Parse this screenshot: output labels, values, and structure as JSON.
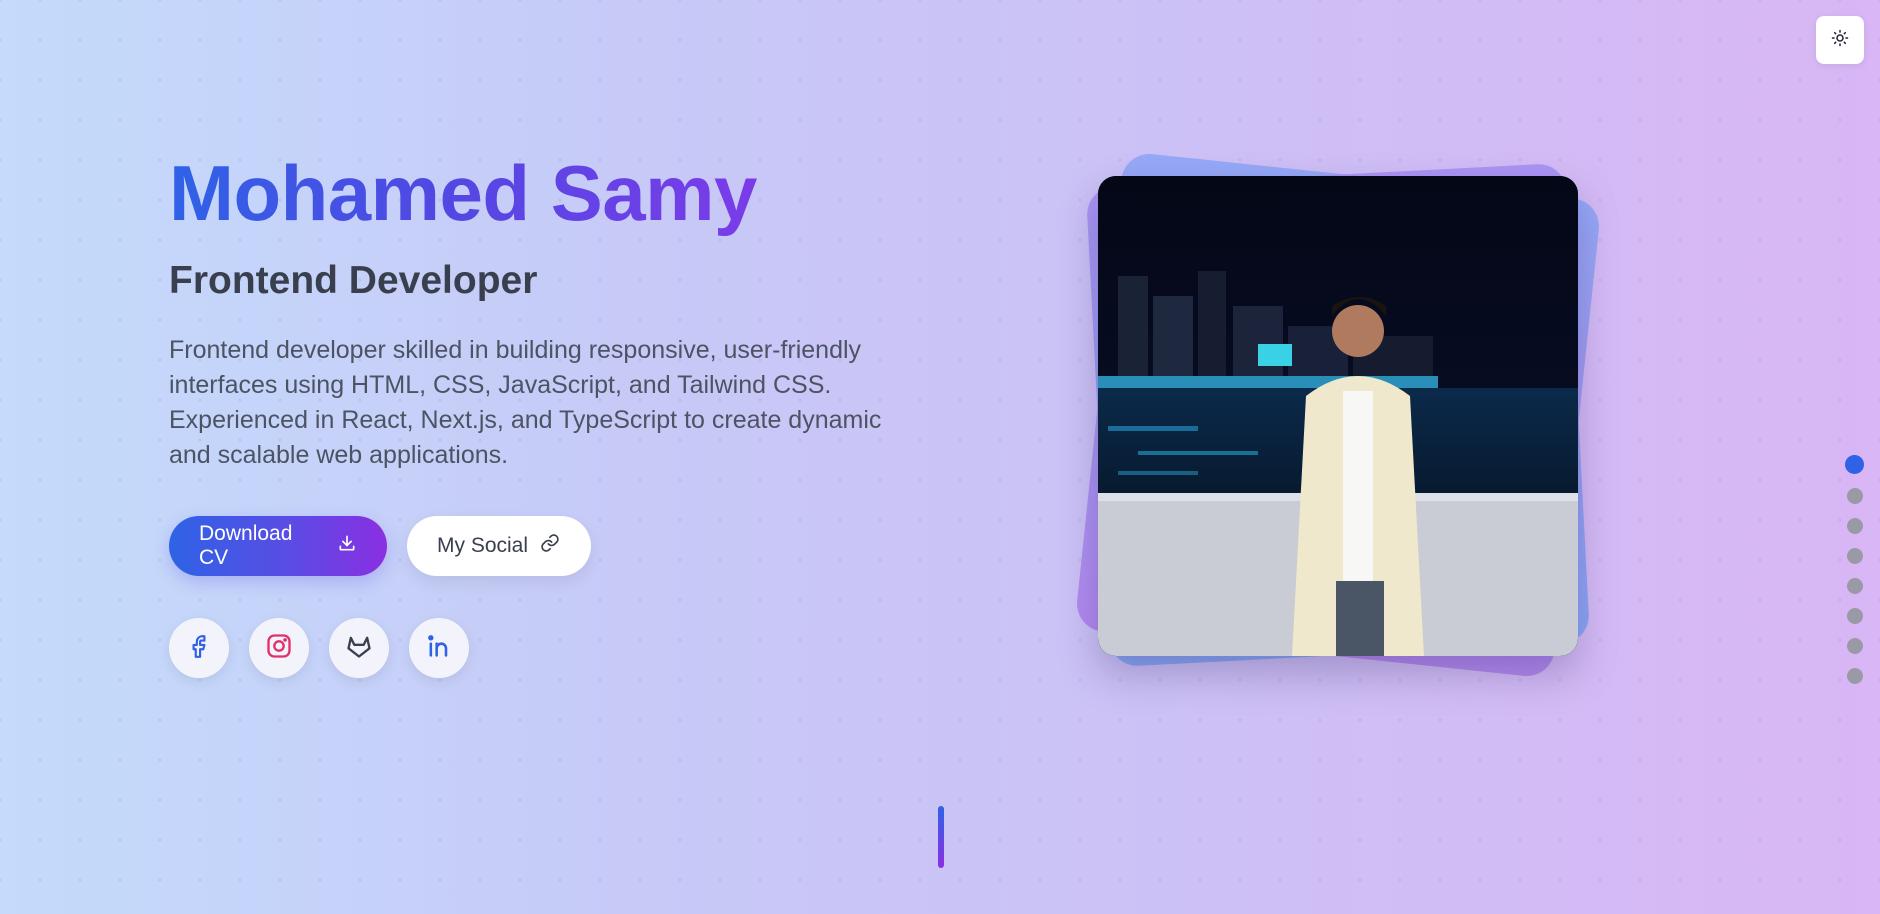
{
  "hero": {
    "name": "Mohamed Samy",
    "role": "Frontend Developer",
    "bio": "Frontend developer skilled in building responsive, user-friendly interfaces using HTML, CSS, JavaScript, and Tailwind CSS. Experienced in React, Next.js, and TypeScript to create dynamic and scalable web applications."
  },
  "actions": {
    "download_cv_label": "Download CV",
    "download_icon": "download-icon",
    "my_social_label": "My Social",
    "link_icon": "link-icon"
  },
  "socials": [
    {
      "name": "facebook",
      "icon": "facebook-icon",
      "color": "#2f62e6"
    },
    {
      "name": "instagram",
      "icon": "instagram-icon",
      "color": "#e1306c"
    },
    {
      "name": "gitlab",
      "icon": "gitlab-icon",
      "color": "#3a3f4d"
    },
    {
      "name": "linkedin",
      "icon": "linkedin-icon",
      "color": "#2f62e6"
    }
  ],
  "theme_toggle": {
    "icon": "sun-icon"
  },
  "section_nav": {
    "count": 8,
    "active_index": 0
  },
  "colors": {
    "accent_blue": "#2f62e6",
    "accent_purple": "#8a2fe2",
    "text_dark": "#3a3f4d"
  }
}
